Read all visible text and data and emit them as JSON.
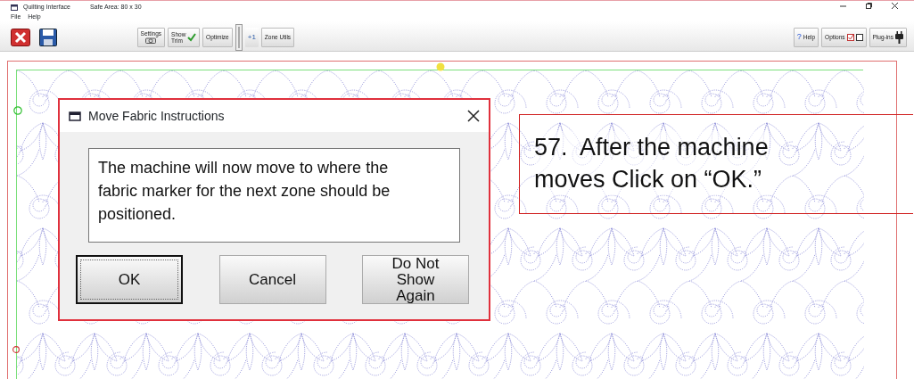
{
  "window": {
    "title": "Quilting Interface",
    "safe_area": "Safe Area: 80 x 30"
  },
  "menu": [
    {
      "label": "File"
    },
    {
      "label": "Help"
    }
  ],
  "toolbar_left": [
    {
      "kind": "exit"
    },
    {
      "kind": "save"
    }
  ],
  "toolbar_center": [
    {
      "kind": "settings",
      "label": "Settings"
    },
    {
      "kind": "trim",
      "label": "Show Trim",
      "checked": true
    },
    {
      "kind": "plain",
      "label": "Optimize"
    },
    {
      "kind": "stepper",
      "label": "+1"
    },
    {
      "kind": "plain",
      "label": "Zone Utils"
    }
  ],
  "toolbar_right": [
    {
      "kind": "help",
      "glyph": "?",
      "label": "Help"
    },
    {
      "kind": "options",
      "label": "Options",
      "checked": true
    },
    {
      "kind": "plugins",
      "label": "Plug-ins"
    }
  ],
  "dialog": {
    "title": "Move Fabric Instructions",
    "message": "The machine will now move to where the fabric marker for the next zone should be positioned.",
    "buttons": [
      {
        "label": "OK",
        "default": true
      },
      {
        "label": "Cancel",
        "default": false
      },
      {
        "label": "Do Not Show Again",
        "default": false
      }
    ]
  },
  "callout": {
    "lines": [
      "57.  After the machine",
      "moves Click on “OK.”"
    ]
  }
}
